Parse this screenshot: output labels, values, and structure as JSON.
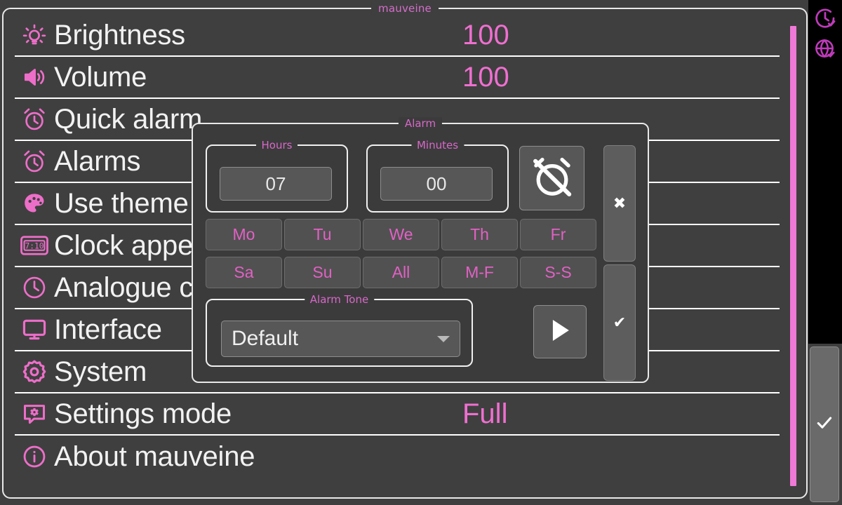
{
  "window": {
    "title": "mauveine"
  },
  "theme": {
    "accent": "#ef6fd0",
    "accent_dim": "#d46ecb",
    "window_bg": "#3f3f3f",
    "dialog_bg": "#3b3b3b",
    "text": "#f2f2f2",
    "border": "#e8e8e8",
    "statusbar_bg": "#000000",
    "statusbar_icon": "#bf3bbb"
  },
  "settings_list": {
    "rows": [
      {
        "icon": "brightness-bulb-icon",
        "label": "Brightness",
        "value": "100"
      },
      {
        "icon": "volume-speaker-icon",
        "label": "Volume",
        "value": "100"
      },
      {
        "icon": "alarm-clock-icon",
        "label": "Quick alarm",
        "value": ""
      },
      {
        "icon": "alarm-clock-icon",
        "label": "Alarms",
        "value": ""
      },
      {
        "icon": "palette-icon",
        "label": "Use theme",
        "value": ""
      },
      {
        "icon": "digital-clock-icon",
        "label": "Clock appearance",
        "value": ""
      },
      {
        "icon": "analog-clock-icon",
        "label": "Analogue clock",
        "value": ""
      },
      {
        "icon": "monitor-icon",
        "label": "Interface",
        "value": ""
      },
      {
        "icon": "gear-icon",
        "label": "System",
        "value": ""
      },
      {
        "icon": "settings-mode-icon",
        "label": "Settings mode",
        "value": "Full"
      },
      {
        "icon": "info-icon",
        "label": "About mauveine",
        "value": ""
      }
    ]
  },
  "statusbar": {
    "icons": [
      {
        "name": "clock-check-icon"
      },
      {
        "name": "globe-check-icon"
      }
    ],
    "confirm_label": "✔"
  },
  "alarm_dialog": {
    "title": "Alarm",
    "hours": {
      "legend": "Hours",
      "value": "07"
    },
    "minutes": {
      "legend": "Minutes",
      "value": "00"
    },
    "alarm_toggle_icon": "alarm-off-icon",
    "cancel_label": "✖",
    "ok_label": "✔",
    "days": [
      {
        "label": "Mo"
      },
      {
        "label": "Tu"
      },
      {
        "label": "We"
      },
      {
        "label": "Th"
      },
      {
        "label": "Fr"
      },
      {
        "label": "Sa"
      },
      {
        "label": "Su"
      },
      {
        "label": "All"
      },
      {
        "label": "M-F"
      },
      {
        "label": "S-S"
      }
    ],
    "tone": {
      "legend": "Alarm Tone",
      "selected": "Default"
    },
    "play_icon": "play-icon"
  }
}
